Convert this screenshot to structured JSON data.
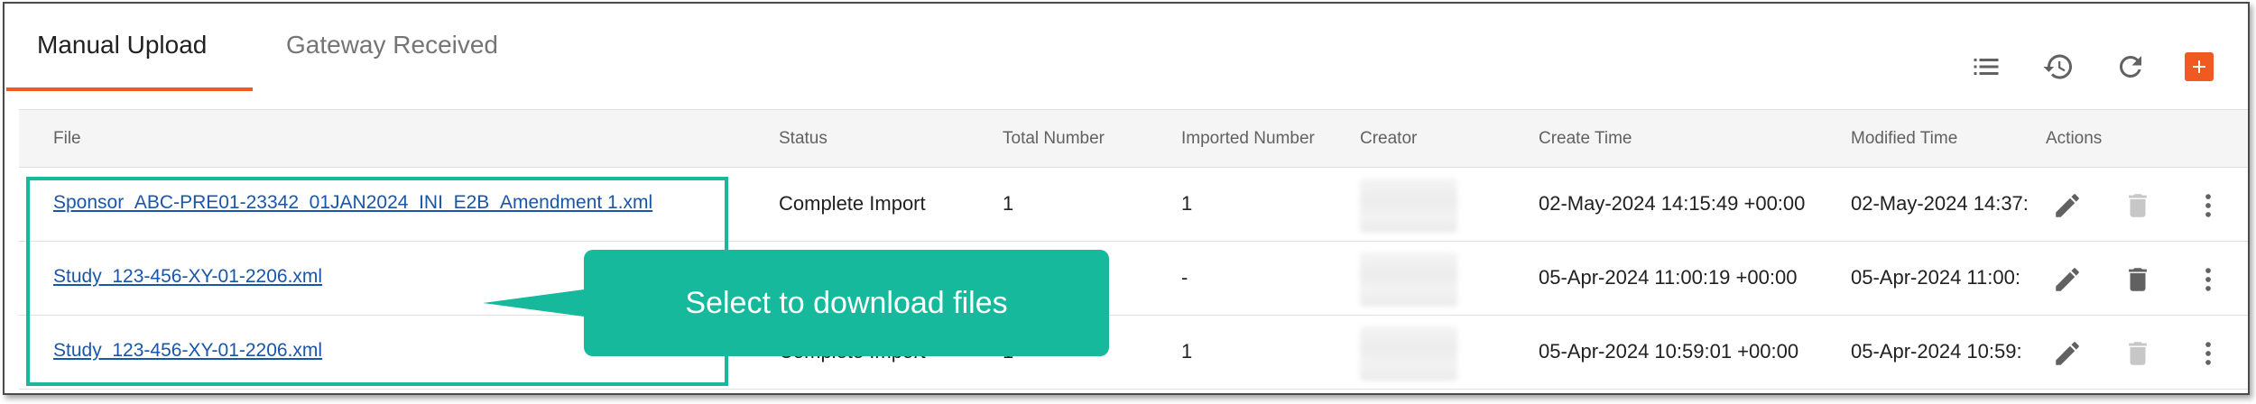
{
  "tabs": [
    {
      "label": "Manual Upload",
      "active": true
    },
    {
      "label": "Gateway Received",
      "active": false
    }
  ],
  "toolbar": {
    "icons": [
      "list-icon",
      "history-icon",
      "refresh-icon",
      "add-icon"
    ],
    "accent_color": "#f05a22"
  },
  "table": {
    "columns": [
      "File",
      "Status",
      "Total Number",
      "Imported Number",
      "Creator",
      "Create Time",
      "Modified Time",
      "Actions"
    ],
    "rows": [
      {
        "file": "Sponsor_ABC-PRE01-23342_01JAN2024_INI_E2B_Amendment 1.xml",
        "status": "Complete Import",
        "total": "1",
        "imported": "1",
        "create_time": "02-May-2024 14:15:49 +00:00",
        "modified_time": "02-May-2024 14:37:",
        "delete_enabled": false
      },
      {
        "file": "Study_123-456-XY-01-2206.xml",
        "status": "",
        "total": "",
        "imported": "-",
        "create_time": "05-Apr-2024 11:00:19 +00:00",
        "modified_time": "05-Apr-2024 11:00:",
        "delete_enabled": true
      },
      {
        "file": "Study_123-456-XY-01-2206.xml",
        "status": "Complete Import",
        "total": "1",
        "imported": "1",
        "create_time": "05-Apr-2024 10:59:01 +00:00",
        "modified_time": "05-Apr-2024 10:59:",
        "delete_enabled": false
      }
    ]
  },
  "callout": {
    "text": "Select to download files",
    "color": "#16b99b"
  }
}
